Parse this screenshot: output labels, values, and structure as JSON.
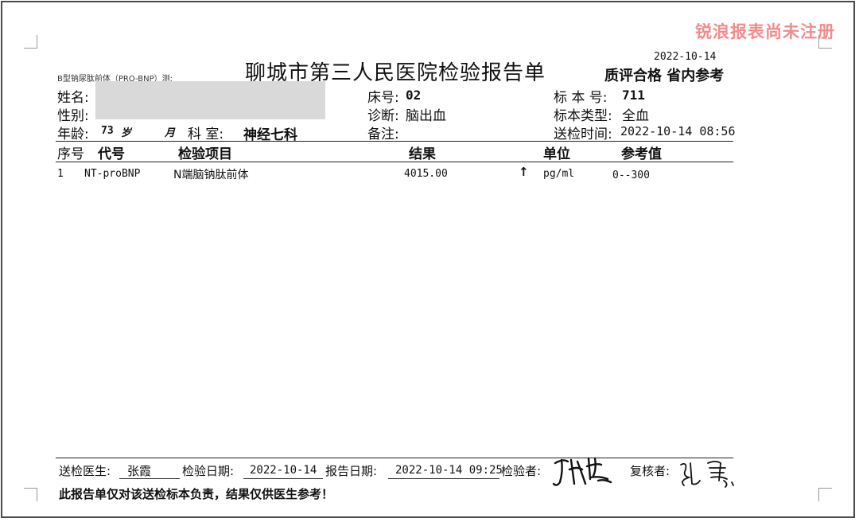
{
  "watermark": "锐浪报表尚未注册",
  "report": {
    "title": "聊城市第三人民医院检验报告单",
    "print_date": "2022-10-14",
    "quality_tag": "质评合格  省内参考",
    "test_note": "B型钠尿肽前体（PRO-BNP）测;"
  },
  "patient": {
    "name_label": "姓名:",
    "sex_label": "性别:",
    "age_label": "年龄:",
    "age_value": "73",
    "age_unit_year": "岁",
    "age_unit_month": "月",
    "dept_label": "科  室:",
    "dept_value": "神经七科",
    "bed_label": "床号:",
    "bed_value": "02",
    "diagnosis_label": "诊断:",
    "diagnosis_value": "脑出血",
    "remark_label": "备注:",
    "sample_no_label": "标 本 号:",
    "sample_no_value": "711",
    "sample_type_label": "标本类型:",
    "sample_type_value": "全血",
    "send_time_label": "送检时间:",
    "send_time_value": "2022-10-14 08:56"
  },
  "table": {
    "headers": {
      "seq": "序号",
      "code": "代号",
      "item": "检验项目",
      "result": "结果",
      "unit": "单位",
      "reference": "参考值"
    },
    "rows": [
      {
        "seq": "1",
        "code": "NT-proBNP",
        "item": "N端脑钠肽前体",
        "result": "4015.00",
        "flag": "↑",
        "unit": "pg/ml",
        "reference": "0--300"
      }
    ]
  },
  "footer": {
    "doctor_label": "送检医生:",
    "doctor_value": "张霞",
    "test_date_label": "检验日期:",
    "test_date_value": "2022-10-14",
    "report_date_label": "报告日期:",
    "report_date_value": "2022-10-14 09:25",
    "tester_label": "检验者:",
    "reviewer_label": "复核者:",
    "disclaimer": "此报告单仅对该送检标本负责，结果仅供医生参考！"
  }
}
